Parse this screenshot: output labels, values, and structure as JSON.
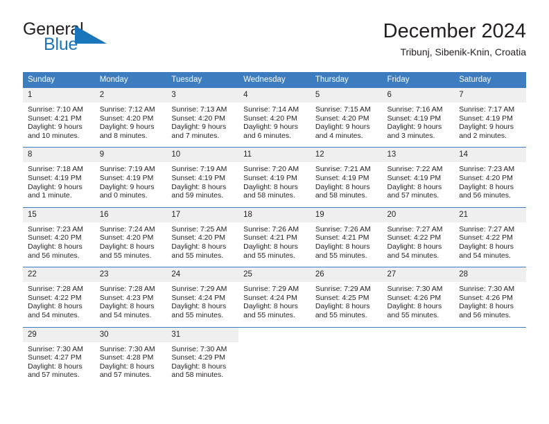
{
  "brand": {
    "name_part1": "General",
    "name_part2": "Blue",
    "logo_icon": "triangle-icon",
    "accent_color": "#1b75bb"
  },
  "header": {
    "title": "December 2024",
    "subtitle": "Tribunj, Sibenik-Knin, Croatia"
  },
  "colors": {
    "header_band": "#3c7cbf",
    "daynum_band": "#efeff0",
    "text": "#231f20",
    "brand_blue": "#1b75bb"
  },
  "weekday_headers": [
    "Sunday",
    "Monday",
    "Tuesday",
    "Wednesday",
    "Thursday",
    "Friday",
    "Saturday"
  ],
  "labels": {
    "sunrise_prefix": "Sunrise:",
    "sunset_prefix": "Sunset:",
    "daylight_prefix": "Daylight:"
  },
  "weeks": [
    [
      {
        "day": "1",
        "sunrise": "Sunrise: 7:10 AM",
        "sunset": "Sunset: 4:21 PM",
        "daylight": "Daylight: 9 hours and 10 minutes."
      },
      {
        "day": "2",
        "sunrise": "Sunrise: 7:12 AM",
        "sunset": "Sunset: 4:20 PM",
        "daylight": "Daylight: 9 hours and 8 minutes."
      },
      {
        "day": "3",
        "sunrise": "Sunrise: 7:13 AM",
        "sunset": "Sunset: 4:20 PM",
        "daylight": "Daylight: 9 hours and 7 minutes."
      },
      {
        "day": "4",
        "sunrise": "Sunrise: 7:14 AM",
        "sunset": "Sunset: 4:20 PM",
        "daylight": "Daylight: 9 hours and 6 minutes."
      },
      {
        "day": "5",
        "sunrise": "Sunrise: 7:15 AM",
        "sunset": "Sunset: 4:20 PM",
        "daylight": "Daylight: 9 hours and 4 minutes."
      },
      {
        "day": "6",
        "sunrise": "Sunrise: 7:16 AM",
        "sunset": "Sunset: 4:19 PM",
        "daylight": "Daylight: 9 hours and 3 minutes."
      },
      {
        "day": "7",
        "sunrise": "Sunrise: 7:17 AM",
        "sunset": "Sunset: 4:19 PM",
        "daylight": "Daylight: 9 hours and 2 minutes."
      }
    ],
    [
      {
        "day": "8",
        "sunrise": "Sunrise: 7:18 AM",
        "sunset": "Sunset: 4:19 PM",
        "daylight": "Daylight: 9 hours and 1 minute."
      },
      {
        "day": "9",
        "sunrise": "Sunrise: 7:19 AM",
        "sunset": "Sunset: 4:19 PM",
        "daylight": "Daylight: 9 hours and 0 minutes."
      },
      {
        "day": "10",
        "sunrise": "Sunrise: 7:19 AM",
        "sunset": "Sunset: 4:19 PM",
        "daylight": "Daylight: 8 hours and 59 minutes."
      },
      {
        "day": "11",
        "sunrise": "Sunrise: 7:20 AM",
        "sunset": "Sunset: 4:19 PM",
        "daylight": "Daylight: 8 hours and 58 minutes."
      },
      {
        "day": "12",
        "sunrise": "Sunrise: 7:21 AM",
        "sunset": "Sunset: 4:19 PM",
        "daylight": "Daylight: 8 hours and 58 minutes."
      },
      {
        "day": "13",
        "sunrise": "Sunrise: 7:22 AM",
        "sunset": "Sunset: 4:19 PM",
        "daylight": "Daylight: 8 hours and 57 minutes."
      },
      {
        "day": "14",
        "sunrise": "Sunrise: 7:23 AM",
        "sunset": "Sunset: 4:20 PM",
        "daylight": "Daylight: 8 hours and 56 minutes."
      }
    ],
    [
      {
        "day": "15",
        "sunrise": "Sunrise: 7:23 AM",
        "sunset": "Sunset: 4:20 PM",
        "daylight": "Daylight: 8 hours and 56 minutes."
      },
      {
        "day": "16",
        "sunrise": "Sunrise: 7:24 AM",
        "sunset": "Sunset: 4:20 PM",
        "daylight": "Daylight: 8 hours and 55 minutes."
      },
      {
        "day": "17",
        "sunrise": "Sunrise: 7:25 AM",
        "sunset": "Sunset: 4:20 PM",
        "daylight": "Daylight: 8 hours and 55 minutes."
      },
      {
        "day": "18",
        "sunrise": "Sunrise: 7:26 AM",
        "sunset": "Sunset: 4:21 PM",
        "daylight": "Daylight: 8 hours and 55 minutes."
      },
      {
        "day": "19",
        "sunrise": "Sunrise: 7:26 AM",
        "sunset": "Sunset: 4:21 PM",
        "daylight": "Daylight: 8 hours and 55 minutes."
      },
      {
        "day": "20",
        "sunrise": "Sunrise: 7:27 AM",
        "sunset": "Sunset: 4:22 PM",
        "daylight": "Daylight: 8 hours and 54 minutes."
      },
      {
        "day": "21",
        "sunrise": "Sunrise: 7:27 AM",
        "sunset": "Sunset: 4:22 PM",
        "daylight": "Daylight: 8 hours and 54 minutes."
      }
    ],
    [
      {
        "day": "22",
        "sunrise": "Sunrise: 7:28 AM",
        "sunset": "Sunset: 4:22 PM",
        "daylight": "Daylight: 8 hours and 54 minutes."
      },
      {
        "day": "23",
        "sunrise": "Sunrise: 7:28 AM",
        "sunset": "Sunset: 4:23 PM",
        "daylight": "Daylight: 8 hours and 54 minutes."
      },
      {
        "day": "24",
        "sunrise": "Sunrise: 7:29 AM",
        "sunset": "Sunset: 4:24 PM",
        "daylight": "Daylight: 8 hours and 55 minutes."
      },
      {
        "day": "25",
        "sunrise": "Sunrise: 7:29 AM",
        "sunset": "Sunset: 4:24 PM",
        "daylight": "Daylight: 8 hours and 55 minutes."
      },
      {
        "day": "26",
        "sunrise": "Sunrise: 7:29 AM",
        "sunset": "Sunset: 4:25 PM",
        "daylight": "Daylight: 8 hours and 55 minutes."
      },
      {
        "day": "27",
        "sunrise": "Sunrise: 7:30 AM",
        "sunset": "Sunset: 4:26 PM",
        "daylight": "Daylight: 8 hours and 55 minutes."
      },
      {
        "day": "28",
        "sunrise": "Sunrise: 7:30 AM",
        "sunset": "Sunset: 4:26 PM",
        "daylight": "Daylight: 8 hours and 56 minutes."
      }
    ],
    [
      {
        "day": "29",
        "sunrise": "Sunrise: 7:30 AM",
        "sunset": "Sunset: 4:27 PM",
        "daylight": "Daylight: 8 hours and 57 minutes."
      },
      {
        "day": "30",
        "sunrise": "Sunrise: 7:30 AM",
        "sunset": "Sunset: 4:28 PM",
        "daylight": "Daylight: 8 hours and 57 minutes."
      },
      {
        "day": "31",
        "sunrise": "Sunrise: 7:30 AM",
        "sunset": "Sunset: 4:29 PM",
        "daylight": "Daylight: 8 hours and 58 minutes."
      },
      {
        "day": "",
        "sunrise": "",
        "sunset": "",
        "daylight": ""
      },
      {
        "day": "",
        "sunrise": "",
        "sunset": "",
        "daylight": ""
      },
      {
        "day": "",
        "sunrise": "",
        "sunset": "",
        "daylight": ""
      },
      {
        "day": "",
        "sunrise": "",
        "sunset": "",
        "daylight": ""
      }
    ]
  ]
}
